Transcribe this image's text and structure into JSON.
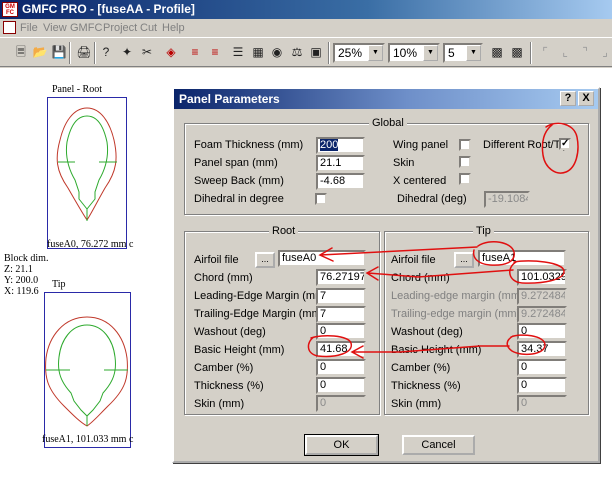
{
  "window": {
    "title": "GMFC PRO - [fuseAA - Profile]",
    "app_icon_text": "GM FC"
  },
  "menubar": {
    "items": [
      "File",
      "View",
      "GMFC",
      "Project",
      "Cut",
      "Help"
    ]
  },
  "toolbar": {
    "zoom_value": "25%",
    "step_value": "10%",
    "count_value": "5",
    "icons": [
      "new-icon",
      "open-icon",
      "save-icon",
      "print-icon",
      "help-icon",
      "wand-icon",
      "cut-tool-icon",
      "target-icon",
      "rail-icon",
      "rail-alt-icon",
      "align-icon",
      "grid-icon",
      "tape-icon",
      "scale-icon",
      "frame-icon",
      "cube-icon",
      "corner-icon",
      "corner-alt-icon",
      "corner-down-icon",
      "corner-up-icon"
    ]
  },
  "workspace": {
    "root_plot_label": "Panel - Root",
    "root_caption": "fuseA0, 76.272 mm c",
    "tip_plot_label": "Tip",
    "tip_caption": "fuseA1, 101.033 mm c",
    "block_info": [
      "Block dim.",
      "Z: 21.1",
      "Y: 200.0",
      "X: 119.6"
    ],
    "outline_color": "#c0392b",
    "inner_color": "#2eaa2e",
    "box_color": "#2a2aa8"
  },
  "dialog": {
    "title": "Panel Parameters",
    "help_button": "?",
    "close_button": "X",
    "global": {
      "title": "Global",
      "foam_thickness_label": "Foam Thickness (mm)",
      "foam_thickness_value": "200",
      "panel_span_label": "Panel span (mm)",
      "panel_span_value": "21.1",
      "sweep_back_label": "Sweep Back (mm)",
      "sweep_back_value": "-4.68",
      "dihedral_degree_label": "Dihedral in degree",
      "dihedral_degree_checked": false,
      "wing_panel_label": "Wing panel",
      "wing_panel_checked": false,
      "different_root_tip_label": "Different Root/Tip",
      "different_root_tip_checked": true,
      "skin_label": "Skin",
      "skin_checked": false,
      "x_centered_label": "X centered",
      "x_centered_checked": false,
      "dihedral_deg_label": "Dihedral (deg)",
      "dihedral_deg_value": "-19.1084"
    },
    "root": {
      "title": "Root",
      "airfoil_label": "Airfoil file",
      "browse_label": "...",
      "airfoil_value": "fuseA0",
      "chord_label": "Chord (mm)",
      "chord_value": "76.2719726",
      "le_margin_label": "Leading-Edge Margin (mm)",
      "le_margin_value": "7",
      "te_margin_label": "Trailing-Edge Margin (mm)",
      "te_margin_value": "7",
      "washout_label": "Washout (deg)",
      "washout_value": "0",
      "basic_height_label": "Basic Height (mm)",
      "basic_height_value": "41.68",
      "camber_label": "Camber (%)",
      "camber_value": "0",
      "thickness_label": "Thickness (%)",
      "thickness_value": "0",
      "skin_label": "Skin (mm)",
      "skin_value": "0"
    },
    "tip": {
      "title": "Tip",
      "airfoil_label": "Airfoil file",
      "browse_label": "...",
      "airfoil_value": "fuseA1",
      "chord_label": "Chord (mm)",
      "chord_value": "101.032958",
      "le_margin_label": "Leading-edge margin (mm)",
      "le_margin_value": "9.27248487",
      "te_margin_label": "Trailing-edge margin (mm)",
      "te_margin_value": "9.27248487",
      "washout_label": "Washout (deg)",
      "washout_value": "0",
      "basic_height_label": "Basic Height (mm)",
      "basic_height_value": "34.37",
      "camber_label": "Camber (%)",
      "camber_value": "0",
      "thickness_label": "Thickness (%)",
      "thickness_value": "0",
      "skin_label": "Skin (mm)",
      "skin_value": "0"
    },
    "ok_label": "OK",
    "cancel_label": "Cancel",
    "annotation_color": "#e01010"
  }
}
